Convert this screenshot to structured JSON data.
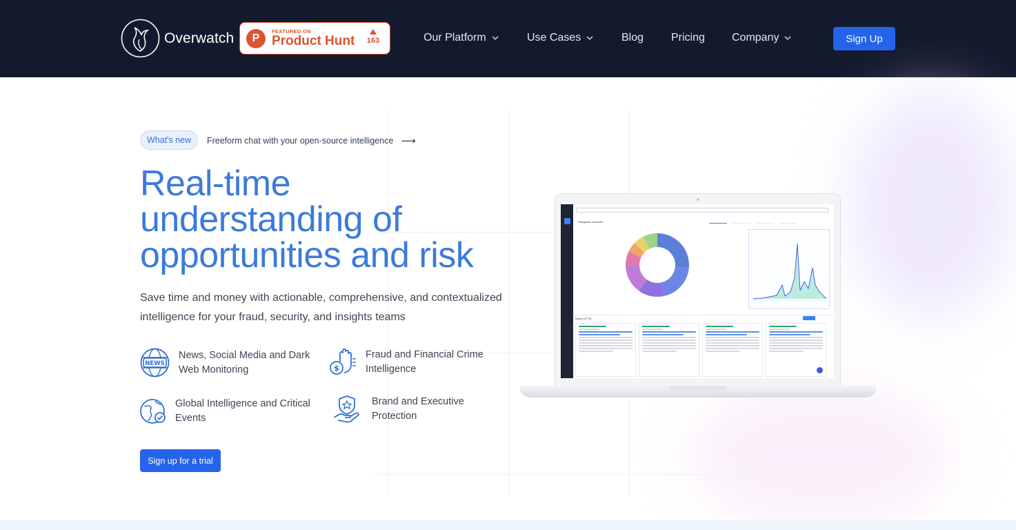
{
  "header": {
    "brand": "Overwatch",
    "product_hunt": {
      "featured_label": "FEATURED ON",
      "name": "Product Hunt",
      "votes": "163"
    },
    "nav": [
      {
        "label": "Our Platform",
        "has_dropdown": true
      },
      {
        "label": "Use Cases",
        "has_dropdown": true
      },
      {
        "label": "Blog",
        "has_dropdown": false
      },
      {
        "label": "Pricing",
        "has_dropdown": false
      },
      {
        "label": "Company",
        "has_dropdown": true
      }
    ],
    "signup_label": "Sign Up"
  },
  "hero": {
    "whats_new_badge": "What's new",
    "whats_new_text": "Freeform chat with your open-source intelligence",
    "whats_new_arrow": "⟶",
    "headline_lines": [
      "Real-time",
      "understanding of",
      "opportunities and risk"
    ],
    "subtitle": "Save time and money with actionable, comprehensive, and contextualized intelligence for your fraud, security, and insights teams",
    "features": [
      {
        "icon": "news-globe-icon",
        "icon_text": "NEWS",
        "label": "News, Social Media and Dark Web Monitoring"
      },
      {
        "icon": "fraud-money-hand-icon",
        "label": "Fraud and Financial Crime Intelligence"
      },
      {
        "icon": "globe-check-icon",
        "label": "Global Intelligence and Critical Events"
      },
      {
        "icon": "shield-hand-icon",
        "label": "Brand and Executive Protection"
      }
    ],
    "cta_label": "Sign up for a trial"
  },
  "dashboard": {
    "panel_title": "Categories Overview",
    "board_title": "Board (2773)"
  },
  "colors": {
    "header_bg": "#141a2e",
    "accent": "#2563eb",
    "headline": "#3b7bd9",
    "product_hunt": "#da552f"
  }
}
